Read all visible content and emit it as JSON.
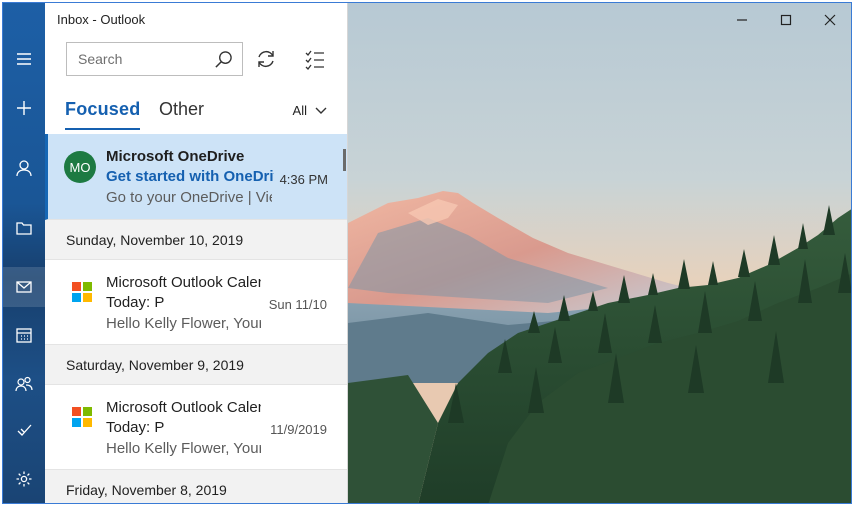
{
  "window": {
    "title": "Inbox - Outlook"
  },
  "search": {
    "placeholder": "Search"
  },
  "tabs": {
    "focused": "Focused",
    "other": "Other"
  },
  "filter": {
    "label": "All"
  },
  "rail_icons": [
    "menu-icon",
    "new-mail-icon",
    "account-icon",
    "folder-icon",
    "mail-icon",
    "calendar-icon",
    "people-icon",
    "todo-icon",
    "settings-icon"
  ],
  "colors": {
    "accent": "#1560b0",
    "selected_bg": "#cde3f7",
    "avatar_green": "#1d7a42"
  },
  "messages": [
    {
      "avatar": "MO",
      "sender": "Microsoft OneDrive",
      "subject": "Get started with OneDrive",
      "time": "4:36 PM",
      "preview": "Go to your OneDrive | View online"
    }
  ],
  "groups": [
    {
      "date": "Sunday, November 10, 2019",
      "message": {
        "sender": "Microsoft Outlook Calendar",
        "subject": "Today: P",
        "time": "Sun 11/10",
        "preview": "Hello Kelly Flower, Your"
      }
    },
    {
      "date": "Saturday, November 9, 2019",
      "message": {
        "sender": "Microsoft Outlook Calendar",
        "subject": "Today: P",
        "time": "11/9/2019",
        "preview": "Hello Kelly Flower, Your"
      }
    },
    {
      "date": "Friday, November 8, 2019"
    }
  ]
}
